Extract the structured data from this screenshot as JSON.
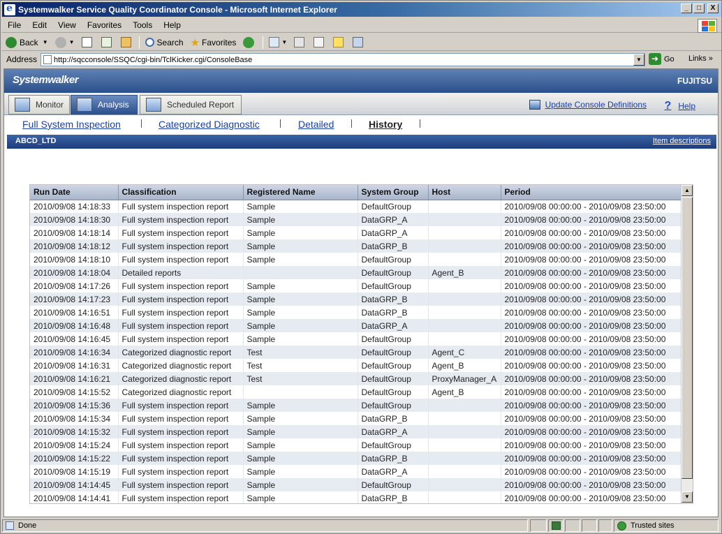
{
  "window": {
    "title": "Systemwalker Service Quality Coordinator Console - Microsoft Internet Explorer",
    "buttons": {
      "minimize": "_",
      "maximize": "□",
      "close": "X"
    }
  },
  "menu": [
    "File",
    "Edit",
    "View",
    "Favorites",
    "Tools",
    "Help"
  ],
  "toolbar": {
    "back": "Back",
    "search": "Search",
    "favorites": "Favorites"
  },
  "address": {
    "label": "Address",
    "url": "http://sqcconsole/SSQC/cgi-bin/TclKicker.cgi/ConsoleBase",
    "go": "Go",
    "links": "Links"
  },
  "app": {
    "brand": "Systemwalker",
    "vendor": "FUJITSU",
    "tabs": [
      "Monitor",
      "Analysis",
      "Scheduled Report"
    ],
    "active_tab": "Analysis",
    "update_link": "Update Console Definitions",
    "help_link": "Help",
    "subtabs": [
      "Full System Inspection",
      "Categorized Diagnostic",
      "Detailed",
      "History"
    ],
    "active_subtab": "History",
    "customer": "ABCD_LTD",
    "item_descriptions": "Item descriptions"
  },
  "table": {
    "columns": [
      "Run Date",
      "Classification",
      "Registered Name",
      "System Group",
      "Host",
      "Period"
    ],
    "rows": [
      [
        "2010/09/08 14:18:33",
        "Full system inspection report",
        "Sample",
        "DefaultGroup",
        "",
        "2010/09/08 00:00:00 - 2010/09/08 23:50:00"
      ],
      [
        "2010/09/08 14:18:30",
        "Full system inspection report",
        "Sample",
        "DataGRP_A",
        "",
        "2010/09/08 00:00:00 - 2010/09/08 23:50:00"
      ],
      [
        "2010/09/08 14:18:14",
        "Full system inspection report",
        "Sample",
        "DataGRP_A",
        "",
        "2010/09/08 00:00:00 - 2010/09/08 23:50:00"
      ],
      [
        "2010/09/08 14:18:12",
        "Full system inspection report",
        "Sample",
        "DataGRP_B",
        "",
        "2010/09/08 00:00:00 - 2010/09/08 23:50:00"
      ],
      [
        "2010/09/08 14:18:10",
        "Full system inspection report",
        "Sample",
        "DefaultGroup",
        "",
        "2010/09/08 00:00:00 - 2010/09/08 23:50:00"
      ],
      [
        "2010/09/08 14:18:04",
        "Detailed reports",
        "",
        "DefaultGroup",
        "Agent_B",
        "2010/09/08 00:00:00 - 2010/09/08 23:50:00"
      ],
      [
        "2010/09/08 14:17:26",
        "Full system inspection report",
        "Sample",
        "DefaultGroup",
        "",
        "2010/09/08 00:00:00 - 2010/09/08 23:50:00"
      ],
      [
        "2010/09/08 14:17:23",
        "Full system inspection report",
        "Sample",
        "DataGRP_B",
        "",
        "2010/09/08 00:00:00 - 2010/09/08 23:50:00"
      ],
      [
        "2010/09/08 14:16:51",
        "Full system inspection report",
        "Sample",
        "DataGRP_B",
        "",
        "2010/09/08 00:00:00 - 2010/09/08 23:50:00"
      ],
      [
        "2010/09/08 14:16:48",
        "Full system inspection report",
        "Sample",
        "DataGRP_A",
        "",
        "2010/09/08 00:00:00 - 2010/09/08 23:50:00"
      ],
      [
        "2010/09/08 14:16:45",
        "Full system inspection report",
        "Sample",
        "DefaultGroup",
        "",
        "2010/09/08 00:00:00 - 2010/09/08 23:50:00"
      ],
      [
        "2010/09/08 14:16:34",
        "Categorized diagnostic report",
        "Test",
        "DefaultGroup",
        "Agent_C",
        "2010/09/08 00:00:00 - 2010/09/08 23:50:00"
      ],
      [
        "2010/09/08 14:16:31",
        "Categorized diagnostic report",
        "Test",
        "DefaultGroup",
        "Agent_B",
        "2010/09/08 00:00:00 - 2010/09/08 23:50:00"
      ],
      [
        "2010/09/08 14:16:21",
        "Categorized diagnostic report",
        "Test",
        "DefaultGroup",
        "ProxyManager_A",
        "2010/09/08 00:00:00 - 2010/09/08 23:50:00"
      ],
      [
        "2010/09/08 14:15:52",
        "Categorized diagnostic report",
        "",
        "DefaultGroup",
        "Agent_B",
        "2010/09/08 00:00:00 - 2010/09/08 23:50:00"
      ],
      [
        "2010/09/08 14:15:36",
        "Full system inspection report",
        "Sample",
        "DefaultGroup",
        "",
        "2010/09/08 00:00:00 - 2010/09/08 23:50:00"
      ],
      [
        "2010/09/08 14:15:34",
        "Full system inspection report",
        "Sample",
        "DataGRP_B",
        "",
        "2010/09/08 00:00:00 - 2010/09/08 23:50:00"
      ],
      [
        "2010/09/08 14:15:32",
        "Full system inspection report",
        "Sample",
        "DataGRP_A",
        "",
        "2010/09/08 00:00:00 - 2010/09/08 23:50:00"
      ],
      [
        "2010/09/08 14:15:24",
        "Full system inspection report",
        "Sample",
        "DefaultGroup",
        "",
        "2010/09/08 00:00:00 - 2010/09/08 23:50:00"
      ],
      [
        "2010/09/08 14:15:22",
        "Full system inspection report",
        "Sample",
        "DataGRP_B",
        "",
        "2010/09/08 00:00:00 - 2010/09/08 23:50:00"
      ],
      [
        "2010/09/08 14:15:19",
        "Full system inspection report",
        "Sample",
        "DataGRP_A",
        "",
        "2010/09/08 00:00:00 - 2010/09/08 23:50:00"
      ],
      [
        "2010/09/08 14:14:45",
        "Full system inspection report",
        "Sample",
        "DefaultGroup",
        "",
        "2010/09/08 00:00:00 - 2010/09/08 23:50:00"
      ],
      [
        "2010/09/08 14:14:41",
        "Full system inspection report",
        "Sample",
        "DataGRP_B",
        "",
        "2010/09/08 00:00:00 - 2010/09/08 23:50:00"
      ]
    ]
  },
  "status": {
    "text": "Done",
    "zone": "Trusted sites"
  },
  "icons": {
    "ie": "ie-icon",
    "back": "back-arrow-icon",
    "forward": "forward-arrow-icon",
    "stop": "stop-icon",
    "refresh": "refresh-icon",
    "home": "home-icon",
    "search": "search-icon",
    "favorites": "star-icon",
    "history": "history-icon",
    "mail": "mail-icon",
    "print": "print-icon",
    "edit": "edit-icon",
    "help": "help-icon"
  },
  "colors": {
    "title_gradient_start": "#0a246a",
    "banner": "#2b4f8a",
    "link": "#1a3fa0",
    "row_alt": "#e6ebf2"
  }
}
